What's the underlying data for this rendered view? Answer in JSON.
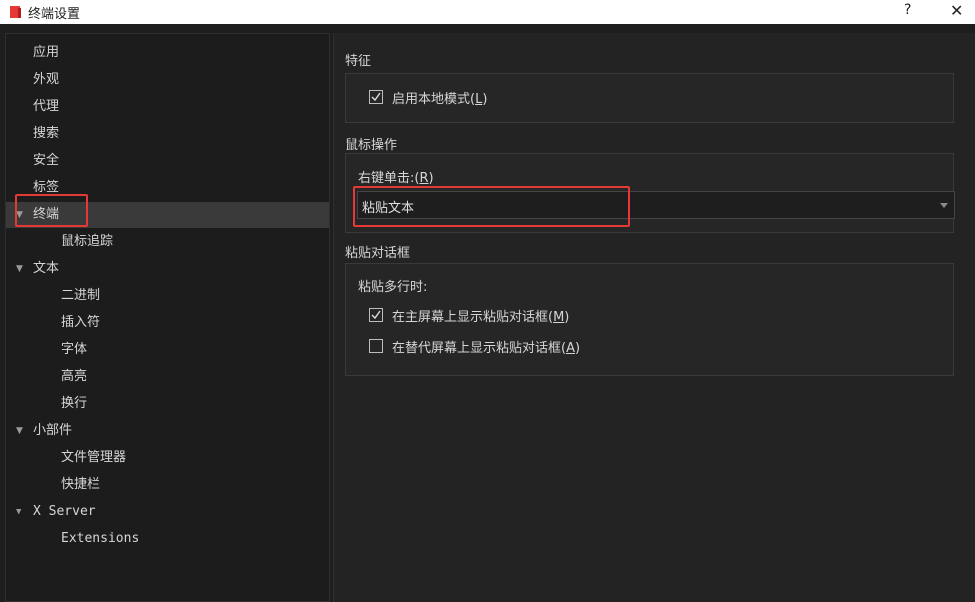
{
  "window": {
    "title": "终端设置",
    "help_label": "?",
    "close_label": "✕"
  },
  "sidebar": {
    "items": [
      {
        "label": "应用"
      },
      {
        "label": "外观"
      },
      {
        "label": "代理"
      },
      {
        "label": "搜索"
      },
      {
        "label": "安全"
      },
      {
        "label": "标签"
      },
      {
        "label": "终端",
        "expanded": true,
        "selected": true
      },
      {
        "label": "鼠标追踪"
      },
      {
        "label": "文本",
        "expanded": true
      },
      {
        "label": "二进制"
      },
      {
        "label": "插入符"
      },
      {
        "label": "字体"
      },
      {
        "label": "高亮"
      },
      {
        "label": "换行"
      },
      {
        "label": "小部件",
        "expanded": true
      },
      {
        "label": "文件管理器"
      },
      {
        "label": "快捷栏"
      },
      {
        "label": "X Server",
        "expanded": true
      },
      {
        "label": "Extensions"
      }
    ]
  },
  "features": {
    "title": "特征",
    "local_mode": {
      "label": "启用本地模式(",
      "mnemonic": "L",
      "suffix": ")",
      "checked": true
    }
  },
  "mouse": {
    "title": "鼠标操作",
    "right_click": {
      "label": "右键单击:(",
      "mnemonic": "R",
      "suffix": ")",
      "value": "粘贴文本"
    }
  },
  "paste_dialog": {
    "title": "粘贴对话框",
    "subtitle": "粘贴多行时:",
    "primary": {
      "label": "在主屏幕上显示粘贴对话框(",
      "mnemonic": "M",
      "suffix": ")",
      "checked": true
    },
    "alternate": {
      "label": "在替代屏幕上显示粘贴对话框(",
      "mnemonic": "A",
      "suffix": ")",
      "checked": false
    }
  },
  "colors": {
    "annotation": "#e53935",
    "selected_row": "#3a3a3a",
    "app_icon": "#e53935"
  }
}
